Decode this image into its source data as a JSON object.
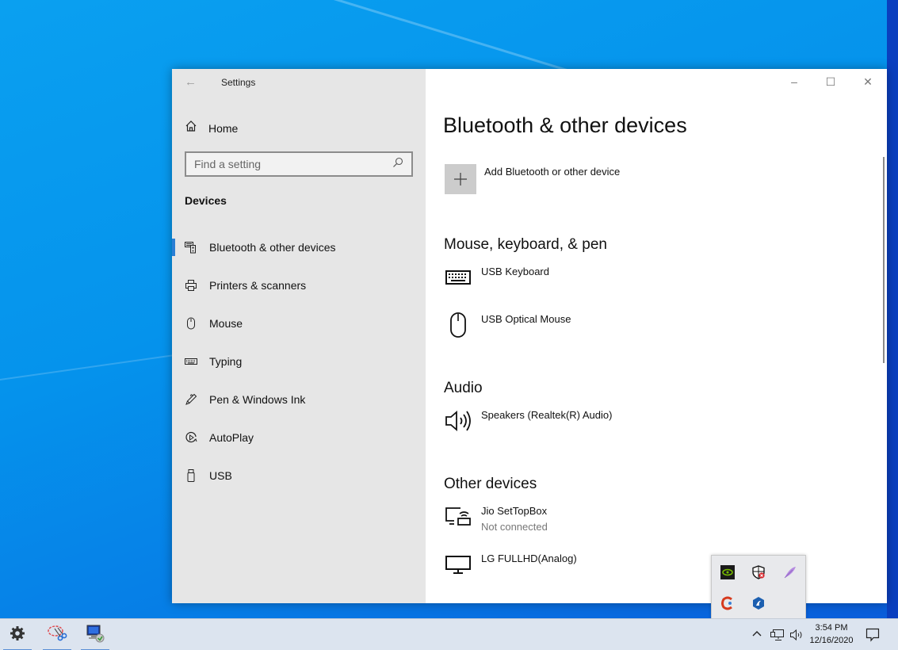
{
  "window": {
    "title": "Settings",
    "controls": {
      "minimize": "–",
      "maximize": "☐",
      "close": "✕"
    }
  },
  "sidebar": {
    "home_label": "Home",
    "search_placeholder": "Find a setting",
    "section_heading": "Devices",
    "items": [
      {
        "label": "Bluetooth & other devices",
        "icon": "bluetooth-devices-icon",
        "active": true
      },
      {
        "label": "Printers & scanners",
        "icon": "printer-icon",
        "active": false
      },
      {
        "label": "Mouse",
        "icon": "mouse-icon",
        "active": false
      },
      {
        "label": "Typing",
        "icon": "keyboard-icon",
        "active": false
      },
      {
        "label": "Pen & Windows Ink",
        "icon": "pen-icon",
        "active": false
      },
      {
        "label": "AutoPlay",
        "icon": "autoplay-icon",
        "active": false
      },
      {
        "label": "USB",
        "icon": "usb-icon",
        "active": false
      }
    ]
  },
  "main": {
    "page_title": "Bluetooth & other devices",
    "add_device_label": "Add Bluetooth or other device",
    "groups": [
      {
        "title": "Mouse, keyboard, & pen",
        "devices": [
          {
            "name": "USB Keyboard",
            "icon": "keyboard-icon"
          },
          {
            "name": "USB Optical Mouse",
            "icon": "mouse-icon"
          }
        ]
      },
      {
        "title": "Audio",
        "devices": [
          {
            "name": "Speakers (Realtek(R) Audio)",
            "icon": "speaker-icon"
          }
        ]
      },
      {
        "title": "Other devices",
        "devices": [
          {
            "name": "Jio SetTopBox",
            "status": "Not connected",
            "icon": "media-device-icon"
          },
          {
            "name": "LG FULLHD(Analog)",
            "icon": "monitor-icon"
          }
        ]
      }
    ]
  },
  "tray_popup": {
    "icons": [
      "nvidia-icon",
      "security-shield-icon",
      "feather-icon",
      "ccleaner-icon",
      "app-blue-icon"
    ]
  },
  "taskbar": {
    "pinned": [
      "settings-gear-icon",
      "snipping-tool-icon",
      "remote-desktop-icon"
    ],
    "tray": [
      "show-hidden-icons-chevron",
      "network-icon",
      "volume-icon"
    ],
    "time": "3:54 PM",
    "date": "12/16/2020",
    "notifications_icon": "action-center-icon"
  },
  "colors": {
    "accent": "#2a7fd4",
    "sidebar_bg": "#e6e6e6",
    "taskbar_bg": "#dce4ef"
  }
}
